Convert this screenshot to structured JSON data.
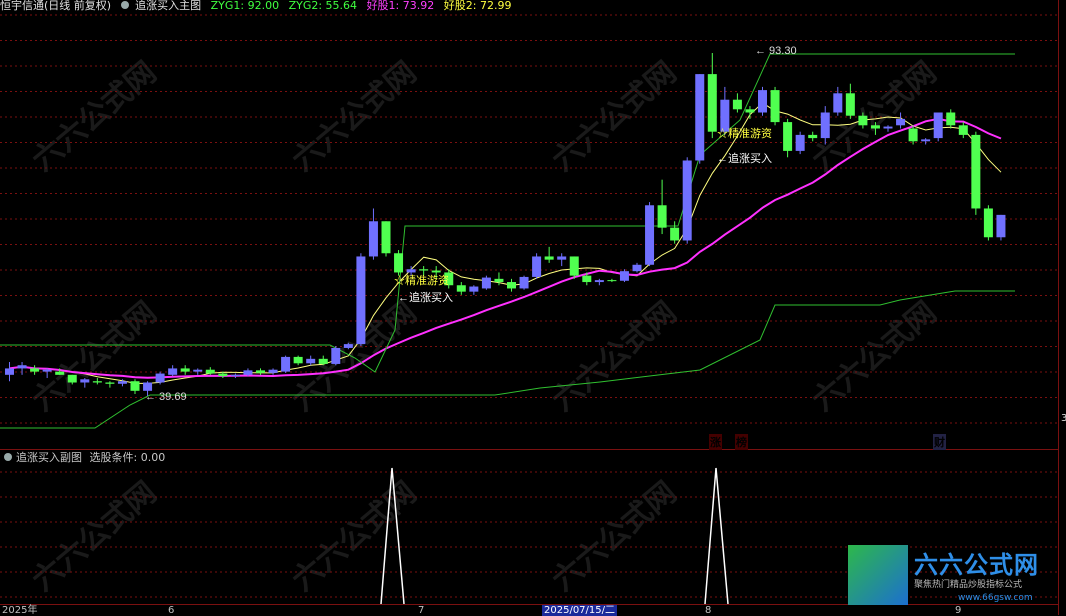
{
  "header": {
    "stock_name": "恒宇信通(日线 前复权)",
    "indicator_name": "追涨买入主图",
    "zyg1": "ZYG1: 92.00",
    "zyg2": "ZYG2: 55.64",
    "haogu1": "好股1: 73.92",
    "haogu2": "好股2: 72.99"
  },
  "main_chart": {
    "high_label": "93.30",
    "low_label": "39.69",
    "signals": [
      {
        "star": "☆精准游资",
        "buy": "追涨买入"
      },
      {
        "star": "☆精准游资",
        "buy": "追涨买入"
      }
    ],
    "markers": [
      {
        "text": "$",
        "color": "#ff3030"
      },
      {
        "text": "涨",
        "color": "#ff8080"
      },
      {
        "text": "榜",
        "color": "#ff8080"
      },
      {
        "text": "财",
        "color": "#d0d0ff"
      }
    ],
    "right_value": "3"
  },
  "sub_chart": {
    "title": "追涨买入副图",
    "condition": "选股条件: 0.00"
  },
  "x_axis": {
    "labels": [
      "2025年",
      "6",
      "7",
      "8",
      "9"
    ],
    "cursor_date": "2025/07/15/二"
  },
  "logo": {
    "title": "六六公式网",
    "subtitle": "聚焦热门精品炒股指标公式",
    "url": "www.66gsw.com"
  },
  "watermark": "六六公式网",
  "chart_data": {
    "type": "candlestick",
    "candles": [
      [
        43,
        45,
        42,
        44
      ],
      [
        44,
        45,
        43,
        44.5
      ],
      [
        44,
        44.5,
        43,
        43.5
      ],
      [
        43.5,
        44,
        42.5,
        43.8
      ],
      [
        43.5,
        44,
        43,
        43
      ],
      [
        43,
        43,
        41.5,
        41.8
      ],
      [
        41.8,
        42.5,
        41,
        42.3
      ],
      [
        42,
        42.5,
        41.5,
        41.8
      ],
      [
        41.8,
        42,
        41,
        41.6
      ],
      [
        41.6,
        42.3,
        41.2,
        42
      ],
      [
        42,
        42.3,
        40,
        40.5
      ],
      [
        40.5,
        42,
        39.7,
        41.8
      ],
      [
        41.8,
        43.5,
        41.5,
        43.2
      ],
      [
        43,
        44.5,
        42.8,
        44
      ],
      [
        44,
        44.5,
        43,
        43.5
      ],
      [
        43.5,
        44,
        43,
        43.8
      ],
      [
        43.8,
        44.2,
        43,
        43.2
      ],
      [
        43.2,
        43.5,
        42.5,
        42.8
      ],
      [
        42.8,
        43.2,
        42.5,
        43
      ],
      [
        43,
        44,
        42.8,
        43.7
      ],
      [
        43.7,
        44,
        43,
        43.3
      ],
      [
        43.3,
        44,
        43,
        43.8
      ],
      [
        43.5,
        46,
        43.3,
        45.8
      ],
      [
        45.8,
        46,
        44.5,
        44.8
      ],
      [
        44.8,
        46,
        44.5,
        45.5
      ],
      [
        45.5,
        46,
        44.5,
        44.7
      ],
      [
        44.7,
        47.5,
        44.5,
        47.2
      ],
      [
        47.2,
        48,
        47,
        47.8
      ],
      [
        47.8,
        62,
        47.5,
        61.5
      ],
      [
        61.5,
        69,
        61,
        67
      ],
      [
        67,
        67,
        61.5,
        62
      ],
      [
        62,
        62.5,
        58.5,
        59
      ],
      [
        59,
        60,
        58.5,
        59.5
      ],
      [
        59.5,
        60,
        58.5,
        59.3
      ],
      [
        59.3,
        60,
        58,
        59
      ],
      [
        59,
        59.5,
        56.5,
        57
      ],
      [
        57,
        57.5,
        55.5,
        56
      ],
      [
        56,
        57,
        55.5,
        56.8
      ],
      [
        56.5,
        58.5,
        56.3,
        58.2
      ],
      [
        58,
        59,
        57,
        57.5
      ],
      [
        57.5,
        58,
        56,
        56.5
      ],
      [
        56.5,
        58.5,
        56.3,
        58.3
      ],
      [
        58.3,
        62,
        58,
        61.5
      ],
      [
        61.5,
        63,
        60.5,
        61
      ],
      [
        61,
        62,
        60,
        61.5
      ],
      [
        61.5,
        61.5,
        58,
        58.5
      ],
      [
        58.5,
        59,
        57,
        57.5
      ],
      [
        57.5,
        58,
        57,
        57.8
      ],
      [
        57.8,
        58,
        57.5,
        57.7
      ],
      [
        57.7,
        59.5,
        57.5,
        59.2
      ],
      [
        59.2,
        60.5,
        59,
        60.2
      ],
      [
        60.2,
        70,
        60,
        69.5
      ],
      [
        69.5,
        73.5,
        65,
        66
      ],
      [
        66,
        67,
        63.5,
        64
      ],
      [
        64,
        77,
        63.5,
        76.5
      ],
      [
        76.5,
        90,
        76,
        90
      ],
      [
        90,
        93.3,
        80,
        81
      ],
      [
        81,
        88,
        80.5,
        86
      ],
      [
        86,
        87,
        84,
        84.5
      ],
      [
        84.5,
        85,
        83,
        84
      ],
      [
        84,
        88,
        83.5,
        87.5
      ],
      [
        87.5,
        88,
        82,
        82.5
      ],
      [
        82.5,
        83,
        77,
        78
      ],
      [
        78,
        81,
        77.5,
        80.5
      ],
      [
        80.5,
        81,
        79.5,
        80
      ],
      [
        80,
        85,
        79,
        84
      ],
      [
        84,
        88,
        83.5,
        87
      ],
      [
        87,
        88.5,
        83,
        83.5
      ],
      [
        83.5,
        84,
        81.5,
        82
      ],
      [
        82,
        82.5,
        80.5,
        81.5
      ],
      [
        81.5,
        82,
        81,
        81.8
      ],
      [
        82,
        84,
        81.5,
        83
      ],
      [
        81.5,
        82,
        79,
        79.5
      ],
      [
        79.5,
        80,
        79,
        79.8
      ],
      [
        80,
        84,
        79.5,
        84
      ],
      [
        84,
        84.5,
        81.5,
        82
      ],
      [
        82,
        82.5,
        80,
        80.5
      ],
      [
        80.5,
        81,
        68,
        69
      ],
      [
        69,
        69.5,
        64,
        64.5
      ],
      [
        64.5,
        68,
        64,
        68
      ]
    ]
  }
}
